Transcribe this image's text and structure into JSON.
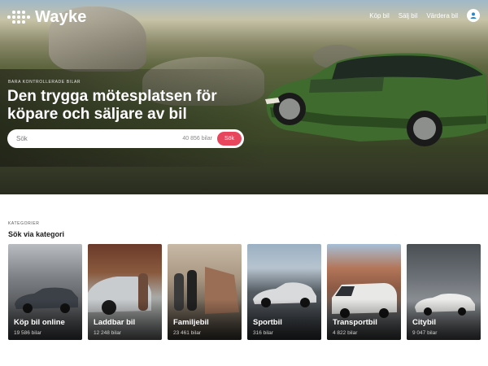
{
  "header": {
    "brand": "Wayke",
    "nav": [
      "Köp bil",
      "Sälj bil",
      "Värdera bil"
    ]
  },
  "hero": {
    "eyebrow": "BARA KONTROLLERADE BILAR",
    "headline": "Den trygga mötesplatsen för köpare och säljare av bil",
    "search": {
      "placeholder": "Sök",
      "count": "40 856 bilar",
      "button": "Sök"
    }
  },
  "categories": {
    "eyebrow": "KATEGORIER",
    "title": "Sök via kategori",
    "items": [
      {
        "name": "Köp bil online",
        "count": "19 586 bilar"
      },
      {
        "name": "Laddbar bil",
        "count": "12 248 bilar"
      },
      {
        "name": "Familjebil",
        "count": "23 461 bilar"
      },
      {
        "name": "Sportbil",
        "count": "316 bilar"
      },
      {
        "name": "Transportbil",
        "count": "4 822 bilar"
      },
      {
        "name": "Citybil",
        "count": "9 047 bilar"
      }
    ]
  },
  "colors": {
    "accent": "#e8465c",
    "hero_car": "#3f6b2e"
  },
  "icons": [
    "wayke-logo-icon",
    "user-icon"
  ]
}
